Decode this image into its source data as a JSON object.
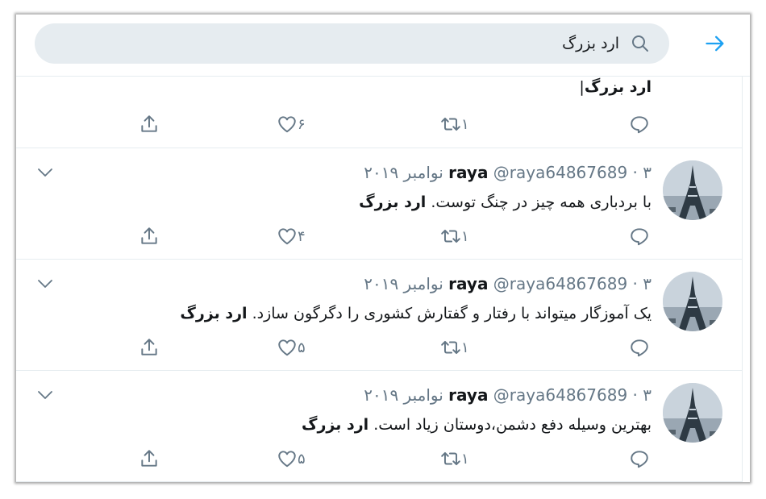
{
  "search": {
    "query": "ارد بزرگ",
    "icons": {
      "back": "arrow-right-icon",
      "search": "search-icon"
    },
    "accent_color": "#1da1f2"
  },
  "tweets": [
    {
      "partial": true,
      "text_plain": "",
      "text_bold": "ارد بزرگ",
      "cursor": "|",
      "retweets": "۱",
      "likes": "۶"
    },
    {
      "name": "raya",
      "handle": "@raya64867689",
      "dot": "·",
      "time": "۳ نوامبر ۲۰۱۹",
      "text_plain": "با بردباری همه چیز در چنگ توست. ",
      "text_bold": "ارد بزرگ",
      "retweets": "۱",
      "likes": "۴"
    },
    {
      "name": "raya",
      "handle": "@raya64867689",
      "dot": "·",
      "time": "۳ نوامبر ۲۰۱۹",
      "text_plain": "یک آموزگار میتواند با رفتار و گفتارش کشوری را دگرگون سازد. ",
      "text_bold": "ارد بزرگ",
      "retweets": "۱",
      "likes": "۵"
    },
    {
      "name": "raya",
      "handle": "@raya64867689",
      "dot": "·",
      "time": "۳ نوامبر ۲۰۱۹",
      "text_plain": "بهترین وسیله دفع دشمن،دوستان زیاد است. ",
      "text_bold": "ارد بزرگ",
      "retweets": "۱",
      "likes": "۵"
    }
  ],
  "colors": {
    "text_primary": "#14171a",
    "text_secondary": "#657786",
    "divider": "#e6ecf0",
    "search_bg": "#e6ecf0"
  }
}
